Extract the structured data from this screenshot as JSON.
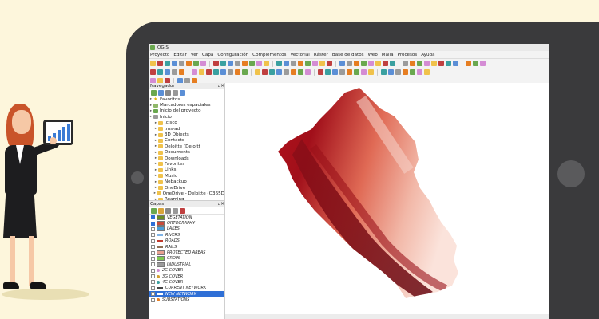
{
  "app": {
    "title": "QGIS",
    "menu": [
      "Proyecto",
      "Editar",
      "Ver",
      "Capa",
      "Configuración",
      "Complementos",
      "Vectorial",
      "Ráster",
      "Base de datos",
      "Web",
      "Malla",
      "Procesos",
      "Ayuda"
    ]
  },
  "browser": {
    "title": "Navegador",
    "items": [
      {
        "label": "Favoritos",
        "icon": "star-icon",
        "level": 0
      },
      {
        "label": "Marcadores espaciales",
        "icon": "bookmark-icon",
        "level": 0
      },
      {
        "label": "Inicio del proyecto",
        "icon": "project-home-icon",
        "level": 0
      },
      {
        "label": "Inicio",
        "icon": "home-folder-icon",
        "level": 0
      },
      {
        "label": ".cisco",
        "icon": "folder-icon",
        "level": 1
      },
      {
        "label": ".ms-ad",
        "icon": "folder-icon",
        "level": 1
      },
      {
        "label": "3D Objects",
        "icon": "folder-icon",
        "level": 1
      },
      {
        "label": "Contacts",
        "icon": "folder-icon",
        "level": 1
      },
      {
        "label": "Deloitte (Deloitt",
        "icon": "folder-icon",
        "level": 1
      },
      {
        "label": "Documents",
        "icon": "folder-icon",
        "level": 1
      },
      {
        "label": "Downloads",
        "icon": "folder-icon",
        "level": 1
      },
      {
        "label": "Favorites",
        "icon": "folder-icon",
        "level": 1
      },
      {
        "label": "Links",
        "icon": "folder-icon",
        "level": 1
      },
      {
        "label": "Music",
        "icon": "folder-icon",
        "level": 1
      },
      {
        "label": "Nebackup",
        "icon": "folder-icon",
        "level": 1
      },
      {
        "label": "OneDrive",
        "icon": "folder-icon",
        "level": 1
      },
      {
        "label": "OneDrive - Deloitte (O365D",
        "icon": "folder-icon",
        "level": 1
      },
      {
        "label": "Roaming",
        "icon": "folder-icon",
        "level": 1
      }
    ]
  },
  "layers": {
    "title": "Capas",
    "items": [
      {
        "label": "VEGETATION",
        "checked": true,
        "color": "#6b8e23",
        "symbol": "raster",
        "selected": false
      },
      {
        "label": "ORTOGRAPHY",
        "checked": true,
        "color": "#c84b3a",
        "symbol": "raster",
        "selected": false
      },
      {
        "label": "LAKES",
        "checked": false,
        "color": "#4a9ed8",
        "symbol": "fill",
        "selected": false
      },
      {
        "label": "RIVERS",
        "checked": false,
        "color": "#7fb3e6",
        "symbol": "line",
        "selected": false
      },
      {
        "label": "ROADS",
        "checked": false,
        "color": "#c0392b",
        "symbol": "line",
        "selected": false
      },
      {
        "label": "RAILS",
        "checked": false,
        "color": "#8e6e53",
        "symbol": "line",
        "selected": false
      },
      {
        "label": "PROTECTED AREAS",
        "checked": false,
        "color": "#e8a090",
        "symbol": "fill",
        "selected": false
      },
      {
        "label": "CROPS",
        "checked": false,
        "color": "#7ec850",
        "symbol": "fill",
        "selected": false
      },
      {
        "label": "INDUSTRIAL",
        "checked": false,
        "color": "#9b9b9b",
        "symbol": "fill",
        "selected": false
      },
      {
        "label": "2G COVER",
        "checked": false,
        "color": "#d48cd4",
        "symbol": "point",
        "selected": false
      },
      {
        "label": "3G COVER",
        "checked": false,
        "color": "#d4a02f",
        "symbol": "point",
        "selected": false
      },
      {
        "label": "4G COVER",
        "checked": false,
        "color": "#3aa0a0",
        "symbol": "point",
        "selected": false
      },
      {
        "label": "CURRENT NETWORK",
        "checked": false,
        "color": "#444444",
        "symbol": "line",
        "selected": false
      },
      {
        "label": "NEW NETWORK",
        "checked": false,
        "color": "#ffffff",
        "symbol": "line",
        "selected": true
      },
      {
        "label": "SUBSTATIONS",
        "checked": false,
        "color": "#e67e22",
        "symbol": "point",
        "selected": false
      }
    ]
  },
  "map": {
    "layer": "ORTOGRAPHY",
    "colors": {
      "light": "#f6d6cc",
      "mid": "#e27a64",
      "dark": "#a81420",
      "deep": "#7d0d17"
    }
  },
  "colors": {
    "background": "#fdf6dc",
    "tablet_frame": "#3a3a3c",
    "selection": "#2f6fd6"
  }
}
